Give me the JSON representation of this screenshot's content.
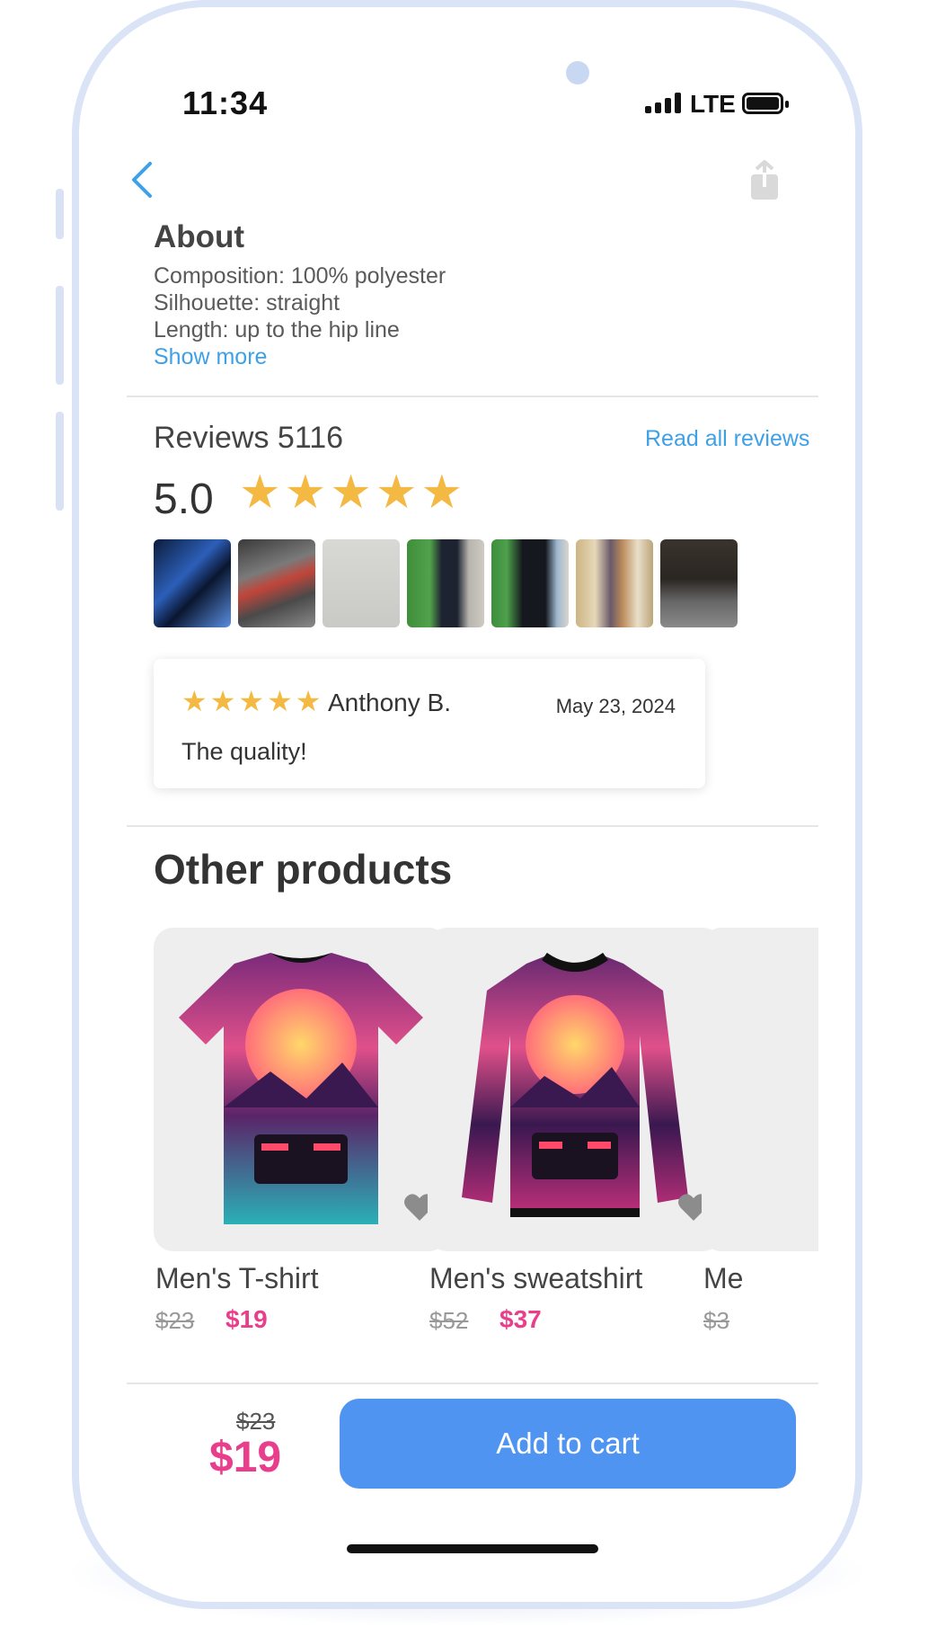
{
  "status": {
    "time": "11:34",
    "network": "LTE"
  },
  "about": {
    "title": "About",
    "lines": [
      "Composition: 100% polyester",
      "Silhouette: straight",
      "Length: up to the hip line"
    ],
    "show_more": "Show more"
  },
  "reviews": {
    "title": "Reviews 5116",
    "read_all": "Read all reviews",
    "rating": "5.0",
    "stars": "★★★★★",
    "review": {
      "stars": "★★★★★",
      "author": "Anthony B.",
      "date": "May 23, 2024",
      "text": "The quality!"
    }
  },
  "other": {
    "title": "Other products",
    "products": [
      {
        "name": "Men's T-shirt",
        "old_price": "$23",
        "price": "$19"
      },
      {
        "name": "Men's sweatshirt",
        "old_price": "$52",
        "price": "$37"
      },
      {
        "name": "Me",
        "old_price": "$3",
        "price": ""
      }
    ]
  },
  "bottom": {
    "old_price": "$23",
    "price": "$19",
    "cart_label": "Add to cart"
  },
  "colors": {
    "accent": "#4f94f0",
    "link": "#3ea0e6",
    "price": "#e83e8c",
    "star": "#f4b942"
  },
  "icons": {
    "back": "chevron-left-icon",
    "share": "share-icon",
    "heart": "heart-icon"
  }
}
